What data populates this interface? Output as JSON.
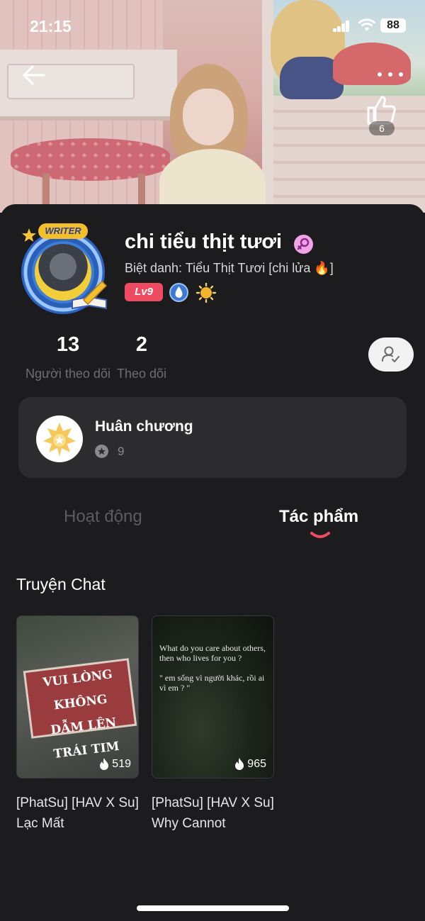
{
  "status_bar": {
    "time": "21:15",
    "battery": "88"
  },
  "header": {
    "like_count": "6"
  },
  "profile": {
    "avatar_badge": "WRITER",
    "name": "chi tiểu thịt tươi",
    "nickname": "Biệt danh: Tiểu Thịt Tươi [chi lửa 🔥]",
    "level": "Lv9"
  },
  "stats": {
    "followers": {
      "value": "13",
      "label": "Người theo dõi"
    },
    "following": {
      "value": "2",
      "label": "Theo dõi"
    }
  },
  "medals": {
    "title": "Huân chương",
    "count": "9"
  },
  "tabs": [
    {
      "label": "Hoạt động",
      "active": false
    },
    {
      "label": "Tác phẩm",
      "active": true
    }
  ],
  "section": {
    "title": "Truyện Chat"
  },
  "stories": [
    {
      "thumb_lines": [
        "VUI LÒNG KHÔNG",
        "DẪM LÊN TRÁI TIM"
      ],
      "views": "519",
      "title": "[PhatSu] [HAV X Su] Lạc Mất"
    },
    {
      "thumb_lines": [
        "What do you care about others, then who lives for you ?",
        "\" em sống vì người khác, rồi ai vì em ? \""
      ],
      "views": "965",
      "title": "[PhatSu] [HAV X Su] Why Cannot"
    }
  ],
  "colors": {
    "accent": "#ef4b63",
    "background": "#1c1c1e",
    "card": "#2c2c2e",
    "tab_indicator": "#ef4b63"
  }
}
